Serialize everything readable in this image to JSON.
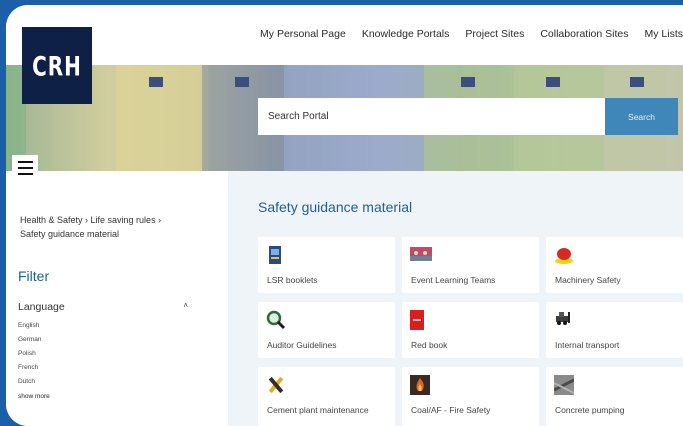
{
  "nav": {
    "links": [
      "My Personal Page",
      "Knowledge Portals",
      "Project Sites",
      "Collaboration Sites",
      "My Lists"
    ]
  },
  "logo": {
    "text": "CRH"
  },
  "search": {
    "placeholder": "Search Portal",
    "button_label": "Search"
  },
  "breadcrumb": {
    "line1": "Health & Safety ›  Life saving rules ›",
    "line2": "Safety guidance material"
  },
  "filter": {
    "title": "Filter",
    "language_label": "Language",
    "caret": "˄",
    "languages": [
      "English",
      "German",
      "Polish",
      "French",
      "Dutch"
    ],
    "show_more": "show more"
  },
  "main": {
    "title": "Safety guidance material",
    "cards": [
      {
        "label": "LSR booklets",
        "icon": "booklet-icon",
        "color": "#4a6fb0"
      },
      {
        "label": "Event Learning Teams",
        "icon": "team-image-icon",
        "color": "#c04a6a"
      },
      {
        "label": "Machinery Safety",
        "icon": "emergency-stop-icon",
        "color": "#d42a22"
      },
      {
        "label": "Auditor Guidelines",
        "icon": "magnifier-icon",
        "color": "#2f6b38"
      },
      {
        "label": "Red book",
        "icon": "red-book-icon",
        "color": "#d81e1e"
      },
      {
        "label": "Internal transport",
        "icon": "forklift-icon",
        "color": "#3e3e3e"
      },
      {
        "label": "Cement plant maintenance",
        "icon": "tools-icon",
        "color": "#e8a922"
      },
      {
        "label": "Coal/AF - Fire Safety",
        "icon": "fire-icon",
        "color": "#c2431c"
      },
      {
        "label": "Concrete pumping",
        "icon": "concrete-icon",
        "color": "#7e7e7e"
      }
    ]
  },
  "colors": {
    "accent": "#1e5f9a",
    "button": "#3f87b8",
    "logo_bg": "#0f2047",
    "border": "#1a5fa8"
  }
}
